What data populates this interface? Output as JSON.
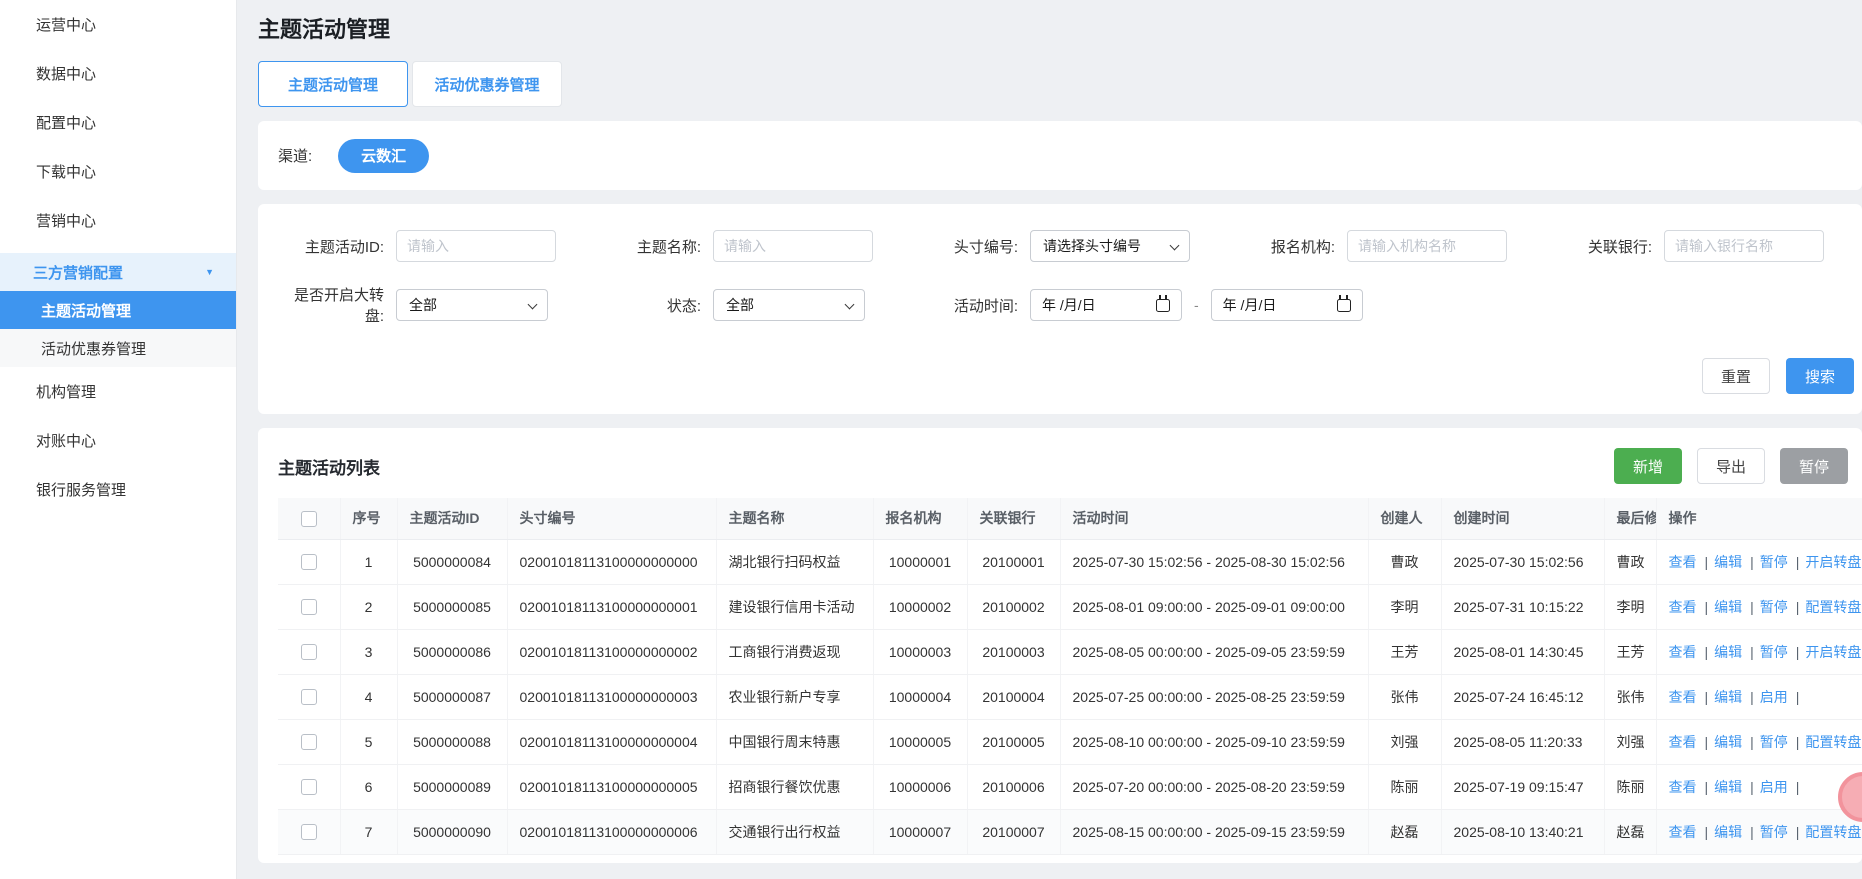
{
  "sidebar": {
    "items_top": [
      "运营中心",
      "数据中心",
      "配置中心",
      "下载中心",
      "营销中心"
    ],
    "group_label": "三方营销配置",
    "sub_items": [
      "主题活动管理",
      "活动优惠券管理"
    ],
    "active_sub": "主题活动管理",
    "items_bottom": [
      "机构管理",
      "对账中心",
      "银行服务管理"
    ]
  },
  "page": {
    "title": "主题活动管理"
  },
  "tabs": [
    {
      "label": "主题活动管理",
      "active": true
    },
    {
      "label": "活动优惠券管理",
      "active": false
    }
  ],
  "channel": {
    "label": "渠道:",
    "selected": "云数汇"
  },
  "filters": {
    "activity_id": {
      "label": "主题活动ID:",
      "placeholder": "请输入"
    },
    "name": {
      "label": "主题名称:",
      "placeholder": "请输入"
    },
    "position_no": {
      "label": "头寸编号:",
      "value": "请选择头寸编号"
    },
    "org": {
      "label": "报名机构:",
      "placeholder": "请输入机构名称"
    },
    "bank": {
      "label": "关联银行:",
      "placeholder": "请输入银行名称"
    },
    "wheel": {
      "label": "是否开启大转盘:",
      "value": "全部"
    },
    "status": {
      "label": "状态:",
      "value": "全部"
    },
    "time": {
      "label": "活动时间:",
      "start_placeholder": "年 /月/日",
      "end_placeholder": "年 /月/日",
      "separator": "-"
    },
    "reset": "重置",
    "search": "搜索"
  },
  "table_section": {
    "title": "主题活动列表",
    "add": "新增",
    "export": "导出",
    "pause": "暂停",
    "columns": [
      "序号",
      "主题活动ID",
      "头寸编号",
      "主题名称",
      "报名机构",
      "关联银行",
      "活动时间",
      "创建人",
      "创建时间",
      "最后修改人",
      "操作"
    ],
    "rows": [
      {
        "seq": "1",
        "activity_id": "5000000084",
        "position_no": "02001018113100000000000",
        "name": "湖北银行扫码权益",
        "org": "10000001",
        "bank": "20100001",
        "time": "2025-07-30 15:02:56 - 2025-08-30 15:02:56",
        "creator": "曹政",
        "created": "2025-07-30 15:02:56",
        "modifier": "曹政",
        "actions": [
          "查看",
          "编辑",
          "暂停",
          "开启转盘"
        ]
      },
      {
        "seq": "2",
        "activity_id": "5000000085",
        "position_no": "02001018113100000000001",
        "name": "建设银行信用卡活动",
        "org": "10000002",
        "bank": "20100002",
        "time": "2025-08-01 09:00:00 - 2025-09-01 09:00:00",
        "creator": "李明",
        "created": "2025-07-31 10:15:22",
        "modifier": "李明",
        "actions": [
          "查看",
          "编辑",
          "暂停",
          "配置转盘"
        ]
      },
      {
        "seq": "3",
        "activity_id": "5000000086",
        "position_no": "02001018113100000000002",
        "name": "工商银行消费返现",
        "org": "10000003",
        "bank": "20100003",
        "time": "2025-08-05 00:00:00 - 2025-09-05 23:59:59",
        "creator": "王芳",
        "created": "2025-08-01 14:30:45",
        "modifier": "王芳",
        "actions": [
          "查看",
          "编辑",
          "暂停",
          "开启转盘"
        ]
      },
      {
        "seq": "4",
        "activity_id": "5000000087",
        "position_no": "02001018113100000000003",
        "name": "农业银行新户专享",
        "org": "10000004",
        "bank": "20100004",
        "time": "2025-07-25 00:00:00 - 2025-08-25 23:59:59",
        "creator": "张伟",
        "created": "2025-07-24 16:45:12",
        "modifier": "张伟",
        "actions": [
          "查看",
          "编辑",
          "启用",
          ""
        ]
      },
      {
        "seq": "5",
        "activity_id": "5000000088",
        "position_no": "02001018113100000000004",
        "name": "中国银行周末特惠",
        "org": "10000005",
        "bank": "20100005",
        "time": "2025-08-10 00:00:00 - 2025-09-10 23:59:59",
        "creator": "刘强",
        "created": "2025-08-05 11:20:33",
        "modifier": "刘强",
        "actions": [
          "查看",
          "编辑",
          "暂停",
          "配置转盘"
        ]
      },
      {
        "seq": "6",
        "activity_id": "5000000089",
        "position_no": "02001018113100000000005",
        "name": "招商银行餐饮优惠",
        "org": "10000006",
        "bank": "20100006",
        "time": "2025-07-20 00:00:00 - 2025-08-20 23:59:59",
        "creator": "陈丽",
        "created": "2025-07-19 09:15:47",
        "modifier": "陈丽",
        "actions": [
          "查看",
          "编辑",
          "启用",
          ""
        ]
      },
      {
        "seq": "7",
        "activity_id": "5000000090",
        "position_no": "02001018113100000000006",
        "name": "交通银行出行权益",
        "org": "10000007",
        "bank": "20100007",
        "time": "2025-08-15 00:00:00 - 2025-09-15 23:59:59",
        "creator": "赵磊",
        "created": "2025-08-10 13:40:21",
        "modifier": "赵磊",
        "actions": [
          "查看",
          "编辑",
          "暂停",
          "配置转盘"
        ]
      }
    ]
  },
  "colors": {
    "accent_blue": "#3e95ef",
    "green_button": "#4cae50",
    "gray_button": "#9c9fa3",
    "sidebar_group_bg": "#e7f2fc",
    "page_bg": "#eef0f3",
    "link_blue": "#3e95ef",
    "floating_widget_pink": "#f6adb4"
  }
}
